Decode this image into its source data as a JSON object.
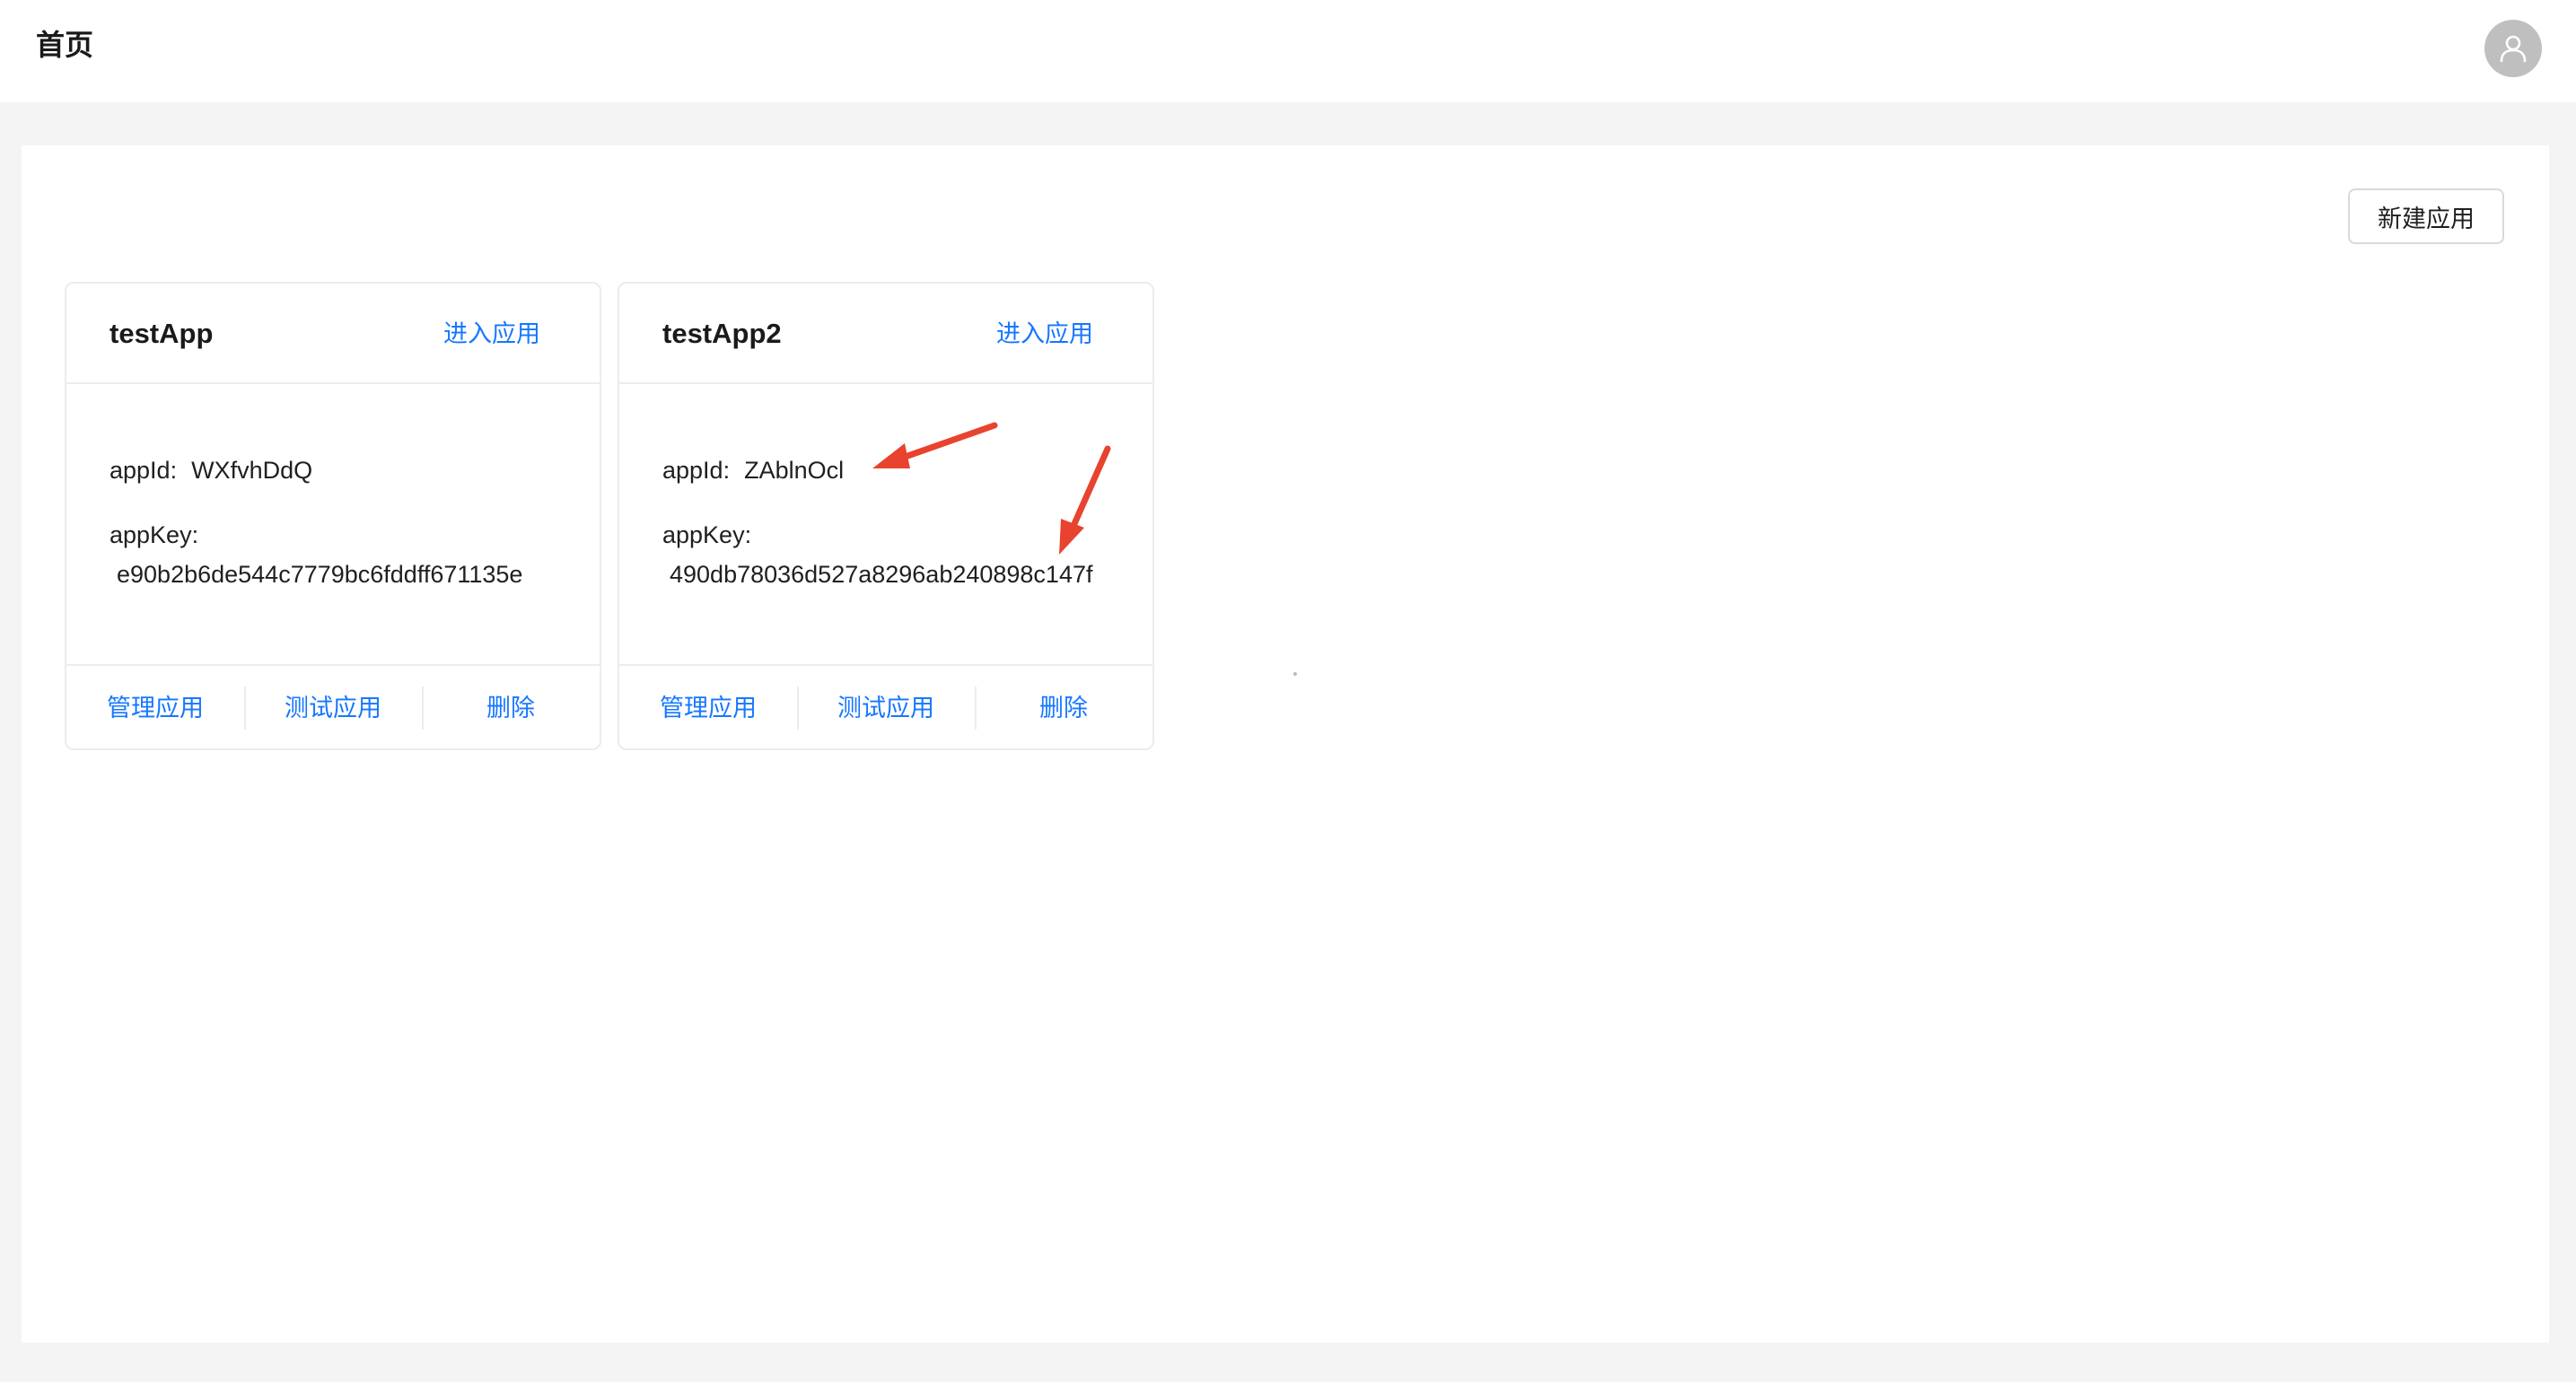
{
  "header": {
    "title": "首页",
    "avatar_icon": "user-icon"
  },
  "toolbar": {
    "new_app_label": "新建应用"
  },
  "apps": [
    {
      "name": "testApp",
      "enter_label": "进入应用",
      "appid_label": "appId:",
      "appid_value": "WXfvhDdQ",
      "appkey_label": "appKey:",
      "appkey_value": "e90b2b6de544c7779bc6fddff671135e",
      "actions": [
        "管理应用",
        "测试应用",
        "删除"
      ]
    },
    {
      "name": "testApp2",
      "enter_label": "进入应用",
      "appid_label": "appId:",
      "appid_value": "ZAblnOcl",
      "appkey_label": "appKey:",
      "appkey_value": "490db78036d527a8296ab240898c147f",
      "actions": [
        "管理应用",
        "测试应用",
        "删除"
      ]
    }
  ],
  "colors": {
    "link": "#1677ff",
    "annotation_arrow": "#e8432f",
    "page_bg": "#f4f4f4"
  }
}
